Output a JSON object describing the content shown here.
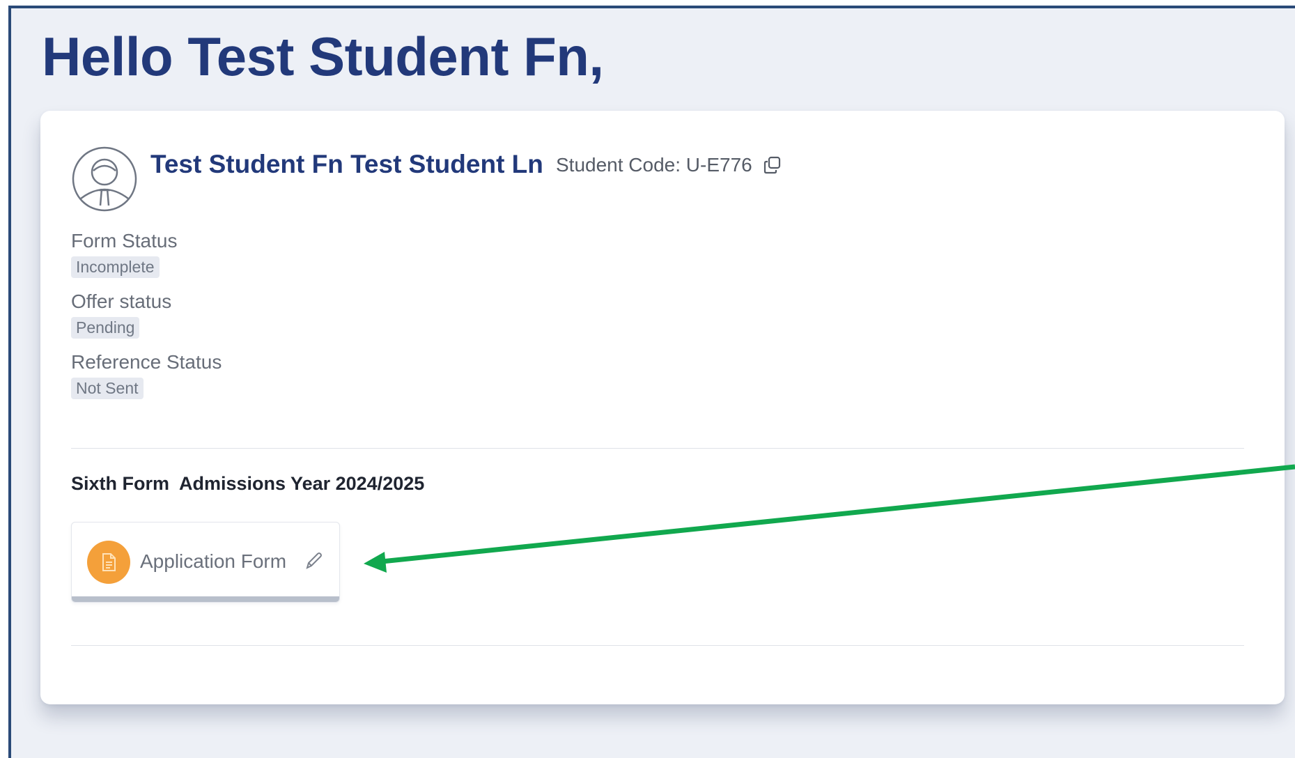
{
  "greeting": "Hello Test Student Fn,",
  "student": {
    "name": "Test Student Fn Test Student Ln",
    "code_label": "Student Code: U-E776"
  },
  "statuses": [
    {
      "label": "Form Status",
      "value": "Incomplete"
    },
    {
      "label": "Offer status",
      "value": "Pending"
    },
    {
      "label": "Reference Status",
      "value": "Not Sent"
    }
  ],
  "section": {
    "title": "Sixth Form  Admissions Year 2024/2025"
  },
  "form_tile": {
    "label": "Application Form",
    "icon": "document-icon"
  },
  "icons": {
    "avatar": "student-avatar-icon",
    "copy": "copy-icon",
    "edit": "pencil-icon"
  },
  "colors": {
    "heading": "#22397a",
    "frame_border": "#2a4a78",
    "tile_icon_bg": "#f4a03a",
    "annotation_arrow": "#11a84e"
  }
}
